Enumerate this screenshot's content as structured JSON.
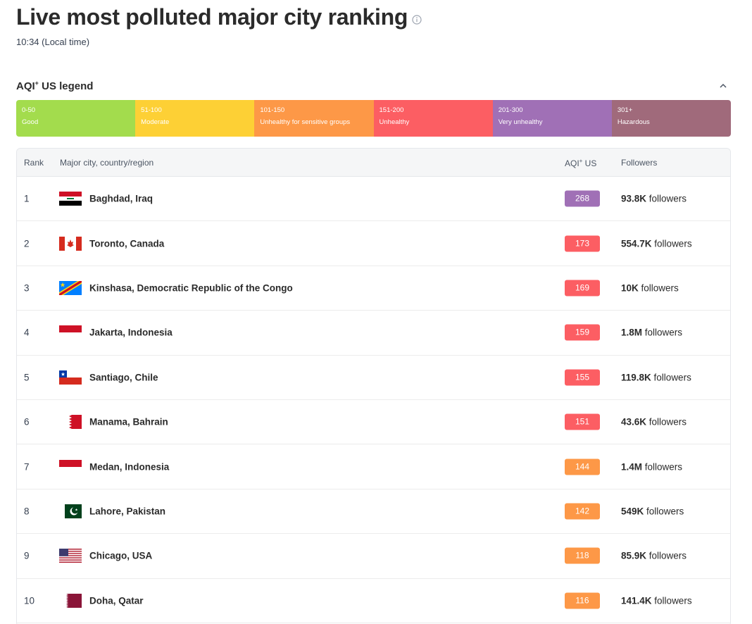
{
  "header": {
    "title": "Live most polluted major city ranking",
    "local_time": "10:34 (Local time)"
  },
  "legend": {
    "title": "AQI",
    "title_sup": "+",
    "title_suffix": " US legend",
    "segments": [
      {
        "range": "0-50",
        "label": "Good",
        "color": "#a3dc4d"
      },
      {
        "range": "51-100",
        "label": "Moderate",
        "color": "#fdd035"
      },
      {
        "range": "101-150",
        "label": "Unhealthy for sensitive groups",
        "color": "#fd9847"
      },
      {
        "range": "151-200",
        "label": "Unhealthy",
        "color": "#fc5e63"
      },
      {
        "range": "201-300",
        "label": "Very unhealthy",
        "color": "#a070b6"
      },
      {
        "range": "301+",
        "label": "Hazardous",
        "color": "#a06a7b"
      }
    ]
  },
  "table": {
    "headers": {
      "rank": "Rank",
      "city": "Major city, country/region",
      "aqi": "AQI",
      "aqi_sup": "+",
      "aqi_suffix": " US",
      "followers": "Followers"
    },
    "rows": [
      {
        "rank": "1",
        "city": "Baghdad, Iraq",
        "flag": "iraq-flag-icon",
        "aqi": "268",
        "aqi_color": "#a070b6",
        "followers_count": "93.8K",
        "followers_label": " followers"
      },
      {
        "rank": "2",
        "city": "Toronto, Canada",
        "flag": "canada-flag-icon",
        "aqi": "173",
        "aqi_color": "#fc5e63",
        "followers_count": "554.7K",
        "followers_label": " followers"
      },
      {
        "rank": "3",
        "city": "Kinshasa, Democratic Republic of the Congo",
        "flag": "drc-flag-icon",
        "aqi": "169",
        "aqi_color": "#fc5e63",
        "followers_count": "10K",
        "followers_label": " followers"
      },
      {
        "rank": "4",
        "city": "Jakarta, Indonesia",
        "flag": "indonesia-flag-icon",
        "aqi": "159",
        "aqi_color": "#fc5e63",
        "followers_count": "1.8M",
        "followers_label": " followers"
      },
      {
        "rank": "5",
        "city": "Santiago, Chile",
        "flag": "chile-flag-icon",
        "aqi": "155",
        "aqi_color": "#fc5e63",
        "followers_count": "119.8K",
        "followers_label": " followers"
      },
      {
        "rank": "6",
        "city": "Manama, Bahrain",
        "flag": "bahrain-flag-icon",
        "aqi": "151",
        "aqi_color": "#fc5e63",
        "followers_count": "43.6K",
        "followers_label": " followers"
      },
      {
        "rank": "7",
        "city": "Medan, Indonesia",
        "flag": "indonesia-flag-icon",
        "aqi": "144",
        "aqi_color": "#fd9847",
        "followers_count": "1.4M",
        "followers_label": " followers"
      },
      {
        "rank": "8",
        "city": "Lahore, Pakistan",
        "flag": "pakistan-flag-icon",
        "aqi": "142",
        "aqi_color": "#fd9847",
        "followers_count": "549K",
        "followers_label": " followers"
      },
      {
        "rank": "9",
        "city": "Chicago, USA",
        "flag": "usa-flag-icon",
        "aqi": "118",
        "aqi_color": "#fd9847",
        "followers_count": "85.9K",
        "followers_label": " followers"
      },
      {
        "rank": "10",
        "city": "Doha, Qatar",
        "flag": "qatar-flag-icon",
        "aqi": "116",
        "aqi_color": "#fd9847",
        "followers_count": "141.4K",
        "followers_label": " followers"
      }
    ]
  }
}
